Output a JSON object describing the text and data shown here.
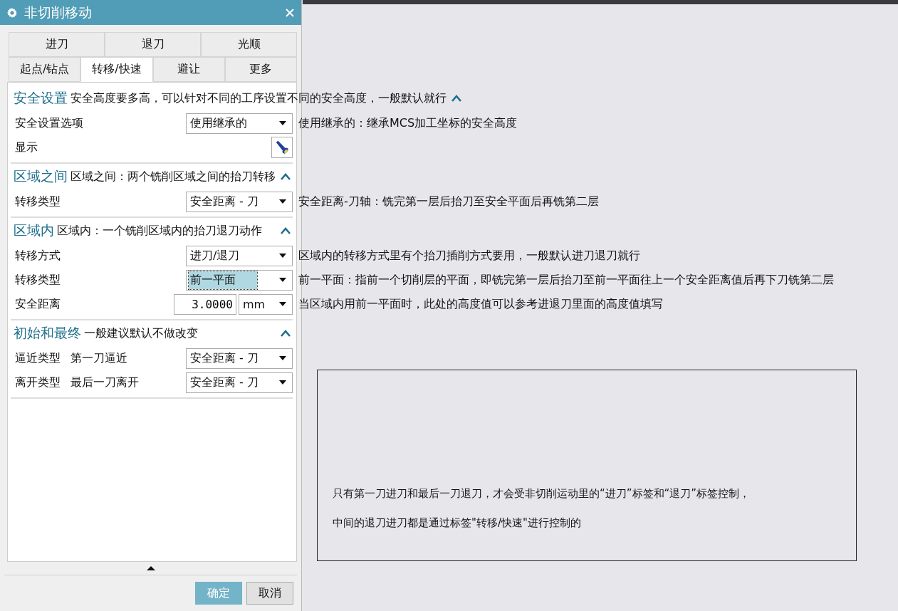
{
  "window": {
    "title": "非切削移动"
  },
  "tab_rows": [
    [
      {
        "label": "进刀",
        "selected": false
      },
      {
        "label": "退刀",
        "selected": false
      },
      {
        "label": "光顺",
        "selected": false
      }
    ],
    [
      {
        "label": "起点/钻点",
        "selected": false
      },
      {
        "label": "转移/快速",
        "selected": true
      },
      {
        "label": "避让",
        "selected": false
      },
      {
        "label": "更多",
        "selected": false
      }
    ]
  ],
  "sections": [
    {
      "title": "安全设置",
      "note": "安全高度要多高，可以针对不同的工序设置不同的安全高度，一般默认就行",
      "expanded": true,
      "rows": [
        {
          "kind": "dropdown",
          "label": "安全设置选项",
          "value": "使用继承的",
          "highlighted": false,
          "note": "使用继承的：继承MCS加工坐标的安全高度"
        },
        {
          "kind": "button",
          "label": "显示"
        }
      ]
    },
    {
      "title": "区域之间",
      "note": "区域之间：两个铣削区域之间的抬刀转移",
      "expanded": true,
      "rows": [
        {
          "kind": "dropdown",
          "label": "转移类型",
          "value": "安全距离 - 刀",
          "highlighted": false,
          "note": "安全距离-刀轴：铣完第一层后抬刀至安全平面后再铣第二层"
        }
      ]
    },
    {
      "title": "区域内",
      "note": "区域内：一个铣削区域内的抬刀退刀动作",
      "expanded": true,
      "rows": [
        {
          "kind": "dropdown",
          "label": "转移方式",
          "value": "进刀/退刀",
          "highlighted": false,
          "note": "区域内的转移方式里有个抬刀插削方式要用，一般默认进刀退刀就行"
        },
        {
          "kind": "dropdown",
          "label": "转移类型",
          "value": "前一平面",
          "highlighted": true,
          "note": "前一平面：指前一个切削层的平面，即铣完第一层后抬刀至前一平面往上一个安全距离值后再下刀铣第二层"
        },
        {
          "kind": "number",
          "label": "安全距离",
          "value": "3.0000",
          "unit": "mm",
          "note": "当区域内用前一平面时，此处的高度值可以参考进退刀里面的高度值填写"
        }
      ]
    },
    {
      "title": "初始和最终",
      "note": "一般建议默认不做改变",
      "expanded": true,
      "rows": [
        {
          "kind": "dropdown",
          "label": "逼近类型",
          "sublabel": "第一刀逼近",
          "value": "安全距离 - 刀",
          "highlighted": false
        },
        {
          "kind": "dropdown",
          "label": "离开类型",
          "sublabel": "最后一刀离开",
          "value": "安全距离 - 刀",
          "highlighted": false
        }
      ]
    }
  ],
  "buttons": [
    {
      "label": "确定",
      "kind": "primary"
    },
    {
      "label": "取消",
      "kind": "normal"
    }
  ],
  "callout": {
    "lines": [
      "只有第一刀进刀和最后一刀退刀，才会受非切削运动里的“进刀”标签和“退刀”标签控制，",
      "中间的退刀进刀都是通过标签\"转移/快速\"进行控制的"
    ]
  }
}
